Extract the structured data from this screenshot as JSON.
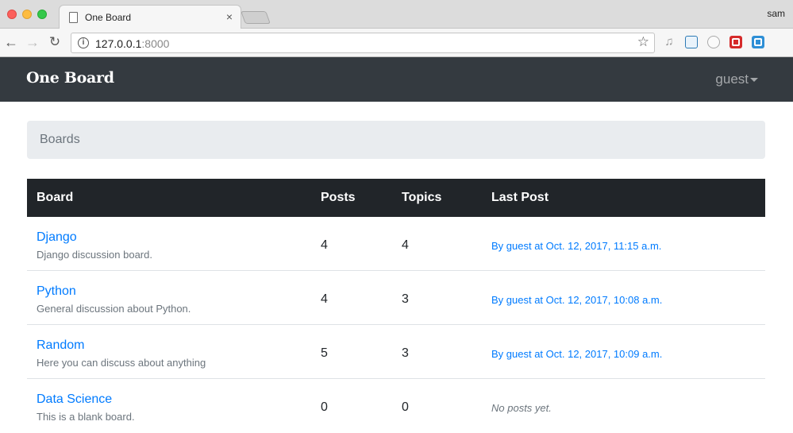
{
  "browser": {
    "tab_title": "One Board",
    "tab_close": "×",
    "profile_name": "sam",
    "url_host": "127.0.0.1",
    "url_port": ":8000",
    "back_glyph": "←",
    "forward_glyph": "→",
    "reload_glyph": "↻",
    "star_glyph": "☆",
    "info_glyph": "i"
  },
  "navbar": {
    "brand": "One Board",
    "user": "guest"
  },
  "breadcrumb": {
    "active": "Boards"
  },
  "table": {
    "headers": {
      "board": "Board",
      "posts": "Posts",
      "topics": "Topics",
      "last_post": "Last Post"
    },
    "rows": [
      {
        "name": "Django",
        "description": "Django discussion board.",
        "posts": "4",
        "topics": "4",
        "last_post": "By guest at Oct. 12, 2017, 11:15 a.m."
      },
      {
        "name": "Python",
        "description": "General discussion about Python.",
        "posts": "4",
        "topics": "3",
        "last_post": "By guest at Oct. 12, 2017, 10:08 a.m."
      },
      {
        "name": "Random",
        "description": "Here you can discuss about anything",
        "posts": "5",
        "topics": "3",
        "last_post": "By guest at Oct. 12, 2017, 10:09 a.m."
      },
      {
        "name": "Data Science",
        "description": "This is a blank board.",
        "posts": "0",
        "topics": "0",
        "last_post": "No posts yet."
      }
    ]
  },
  "colors": {
    "navbar_bg": "#343a40",
    "table_head_bg": "#212529",
    "link": "#007bff",
    "muted": "#6c757d",
    "breadcrumb_bg": "#e9ecef"
  }
}
